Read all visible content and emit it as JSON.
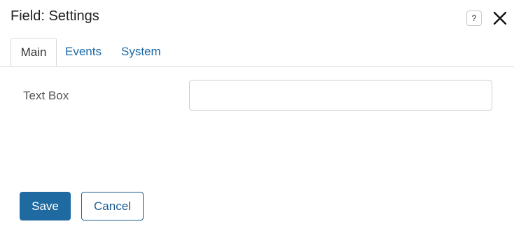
{
  "dialog": {
    "title": "Field: Settings",
    "help_icon_glyph": "?",
    "close_icon": "close-icon"
  },
  "tabs": [
    {
      "label": "Main",
      "active": true
    },
    {
      "label": "Events",
      "active": false
    },
    {
      "label": "System",
      "active": false
    }
  ],
  "form": {
    "text_box_label": "Text Box",
    "text_box_value": "",
    "text_box_placeholder": ""
  },
  "actions": {
    "save_label": "Save",
    "cancel_label": "Cancel"
  },
  "colors": {
    "primary": "#1f6aa1",
    "link": "#1e6aa8",
    "border": "#d9d9d9"
  }
}
